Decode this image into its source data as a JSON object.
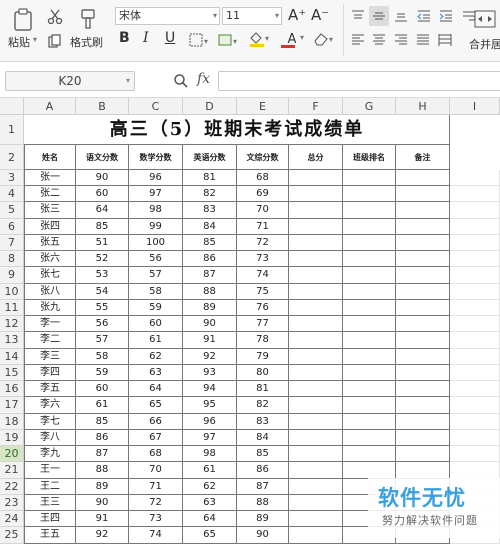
{
  "ribbon": {
    "paste_label": "粘贴",
    "format_painter_label": "格式刷",
    "font_name": "宋体",
    "font_size": "11",
    "merge_label": "合并居",
    "bold": "B",
    "italic": "I",
    "underline": "U",
    "grow_font": "A⁺",
    "shrink_font": "A⁻",
    "font_color_label": "A",
    "accent_color": "#d9342b",
    "highlight_color": "#f5d000"
  },
  "formula_bar": {
    "name_box": "K20",
    "fx": "fx"
  },
  "columns": [
    "A",
    "B",
    "C",
    "D",
    "E",
    "F",
    "G",
    "H",
    "I"
  ],
  "rows": [
    "1",
    "2",
    "3",
    "4",
    "5",
    "6",
    "7",
    "8",
    "9",
    "10",
    "11",
    "12",
    "13",
    "14",
    "15",
    "16",
    "17",
    "18",
    "19",
    "20",
    "21",
    "22",
    "23",
    "24",
    "25"
  ],
  "selected_row": "20",
  "sheet": {
    "title": "高三（5）班期末考试成绩单",
    "headers": [
      "姓名",
      "语文分数",
      "数学分数",
      "英语分数",
      "文综分数",
      "总分",
      "班级排名",
      "备注"
    ],
    "data": [
      [
        "张一",
        "90",
        "96",
        "81",
        "68"
      ],
      [
        "张二",
        "60",
        "97",
        "82",
        "69"
      ],
      [
        "张三",
        "64",
        "98",
        "83",
        "70"
      ],
      [
        "张四",
        "85",
        "99",
        "84",
        "71"
      ],
      [
        "张五",
        "51",
        "100",
        "85",
        "72"
      ],
      [
        "张六",
        "52",
        "56",
        "86",
        "73"
      ],
      [
        "张七",
        "53",
        "57",
        "87",
        "74"
      ],
      [
        "张八",
        "54",
        "58",
        "88",
        "75"
      ],
      [
        "张九",
        "55",
        "59",
        "89",
        "76"
      ],
      [
        "李一",
        "56",
        "60",
        "90",
        "77"
      ],
      [
        "李二",
        "57",
        "61",
        "91",
        "78"
      ],
      [
        "李三",
        "58",
        "62",
        "92",
        "79"
      ],
      [
        "李四",
        "59",
        "63",
        "93",
        "80"
      ],
      [
        "李五",
        "60",
        "64",
        "94",
        "81"
      ],
      [
        "李六",
        "61",
        "65",
        "95",
        "82"
      ],
      [
        "李七",
        "85",
        "66",
        "96",
        "83"
      ],
      [
        "李八",
        "86",
        "67",
        "97",
        "84"
      ],
      [
        "李九",
        "87",
        "68",
        "98",
        "85"
      ],
      [
        "王一",
        "88",
        "70",
        "61",
        "86"
      ],
      [
        "王二",
        "89",
        "71",
        "62",
        "87"
      ],
      [
        "王三",
        "90",
        "72",
        "63",
        "88"
      ],
      [
        "王四",
        "91",
        "73",
        "64",
        "89"
      ],
      [
        "王五",
        "92",
        "74",
        "65",
        "90"
      ]
    ]
  },
  "watermark": {
    "title": "软件无忧",
    "subtitle": "努力解决软件问题"
  }
}
